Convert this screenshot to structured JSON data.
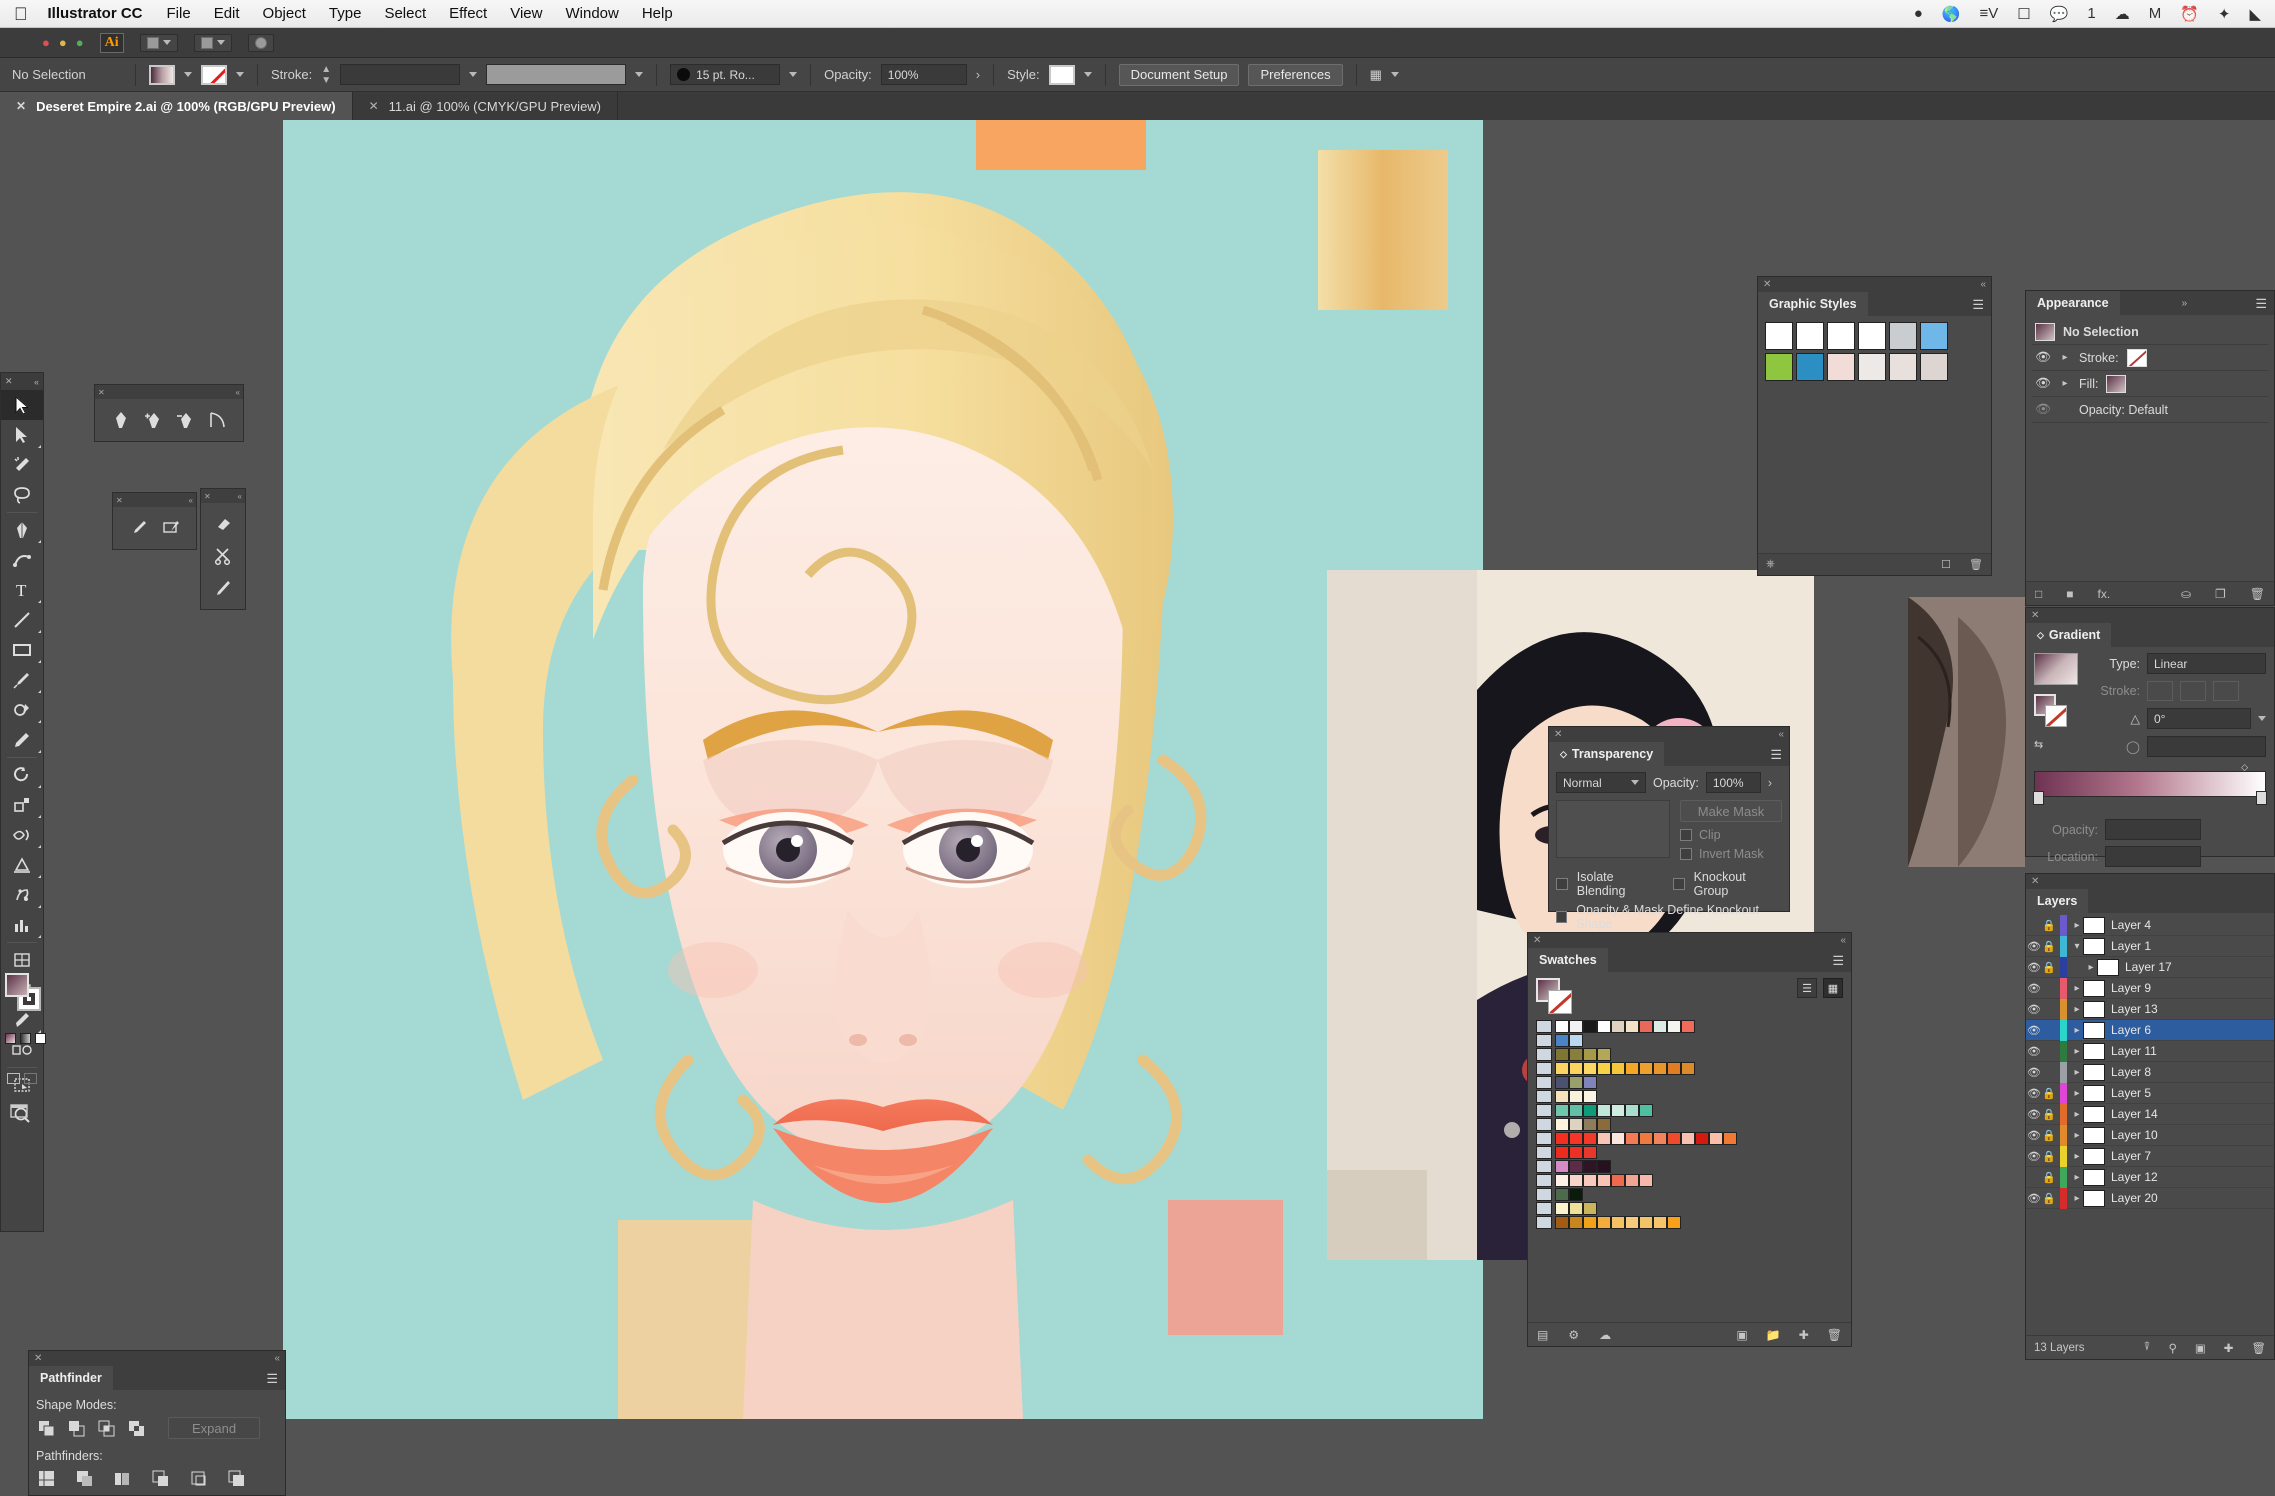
{
  "os_menu": {
    "apple_icon": "apple-icon",
    "app_name": "Illustrator CC",
    "items": [
      "File",
      "Edit",
      "Object",
      "Type",
      "Select",
      "Effect",
      "View",
      "Window",
      "Help"
    ],
    "status_icons": [
      "penguin-icon",
      "globe-icon",
      "input-method-icon",
      "screen-share-icon",
      "wechat-icon",
      "cloud-icon",
      "mail-icon",
      "time-machine-icon",
      "bluetooth-icon",
      "wifi-icon"
    ],
    "status_count": "1"
  },
  "appbar": {
    "logo_text": "Ai",
    "arrange_icon": "arrange-documents-icon",
    "workspace_icon": "workspace-switcher-icon"
  },
  "control_bar": {
    "selection_status": "No Selection",
    "fill_label": "fill-swatch",
    "stroke_label": "Stroke:",
    "stroke_weight": "",
    "brush_definition": "15 pt. Ro...",
    "opacity_label": "Opacity:",
    "opacity_value": "100%",
    "style_label": "Style:",
    "document_setup": "Document Setup",
    "preferences": "Preferences"
  },
  "document_tabs": [
    {
      "title": "Deseret Empire 2.ai @ 100% (RGB/GPU Preview)",
      "active": true
    },
    {
      "title": "11.ai @ 100% (CMYK/GPU Preview)",
      "active": false
    }
  ],
  "tools": [
    {
      "name": "selection-tool",
      "selected": true
    },
    {
      "name": "direct-selection-tool",
      "selected": false
    },
    {
      "name": "magic-wand-tool",
      "selected": false
    },
    {
      "name": "lasso-tool",
      "selected": false
    },
    {
      "name": "pen-tool",
      "selected": false
    },
    {
      "name": "curvature-tool",
      "selected": false
    },
    {
      "name": "type-tool",
      "selected": false
    },
    {
      "name": "line-segment-tool",
      "selected": false
    },
    {
      "name": "rectangle-tool",
      "selected": false
    },
    {
      "name": "paintbrush-tool",
      "selected": false
    },
    {
      "name": "shaper-tool",
      "selected": false
    },
    {
      "name": "pencil-tool",
      "selected": false
    },
    {
      "name": "rotate-tool",
      "selected": false
    },
    {
      "name": "free-transform-tool",
      "selected": false
    },
    {
      "name": "width-tool",
      "selected": false
    },
    {
      "name": "symbol-sprayer-tool",
      "selected": false
    },
    {
      "name": "column-graph-tool",
      "selected": false
    },
    {
      "name": "mesh-tool",
      "selected": false
    },
    {
      "name": "gradient-tool",
      "selected": false
    },
    {
      "name": "eyedropper-tool",
      "selected": false
    },
    {
      "name": "blend-tool",
      "selected": false
    },
    {
      "name": "artboard-tool",
      "selected": false
    },
    {
      "name": "zoom-tool",
      "selected": false
    }
  ],
  "flyouts": {
    "pen": [
      "pen-tool",
      "add-anchor-point-tool",
      "delete-anchor-point-tool",
      "anchor-point-tool"
    ],
    "brush": [
      "paintbrush-tool",
      "blob-brush-tool"
    ],
    "eraser": [
      "eraser-tool",
      "scissors-tool",
      "knife-tool"
    ]
  },
  "pathfinder": {
    "title": "Pathfinder",
    "shape_modes_label": "Shape Modes:",
    "expand_label": "Expand",
    "pathfinders_label": "Pathfinders:",
    "shape_modes": [
      "unite",
      "minus-front",
      "intersect",
      "exclude"
    ],
    "pathfinders": [
      "divide",
      "trim",
      "merge",
      "crop",
      "outline",
      "minus-back"
    ]
  },
  "graphic_styles": {
    "title": "Graphic Styles",
    "row1": [
      "#ffffff",
      "#ffffff",
      "#ffffff",
      "#ffffff",
      "#c9cdd0",
      "#6fb7e8"
    ],
    "row2": [
      "#8ec63f",
      "#2b8fc4",
      "#f2dcd8",
      "#ece9e6",
      "#e8e0dc",
      "#ddd5d1"
    ]
  },
  "appearance": {
    "title": "Appearance",
    "selection": "No Selection",
    "stroke_label": "Stroke:",
    "fill_label": "Fill:",
    "opacity_row": "Opacity: Default"
  },
  "gradient": {
    "title": "Gradient",
    "type_label": "Type:",
    "type_value": "Linear",
    "stroke_label": "Stroke:",
    "angle_value": "0°",
    "opacity_label": "Opacity:",
    "location_label": "Location:",
    "stop_colors": [
      "#6d3352",
      "#ffffff"
    ]
  },
  "transparency": {
    "title": "Transparency",
    "blend_mode": "Normal",
    "opacity_label": "Opacity:",
    "opacity_value": "100%",
    "make_mask": "Make Mask",
    "clip": "Clip",
    "invert_mask": "Invert Mask",
    "isolate_blending": "Isolate Blending",
    "knockout_group": "Knockout Group",
    "knockout_shape": "Opacity & Mask Define Knockout Shape"
  },
  "swatches": {
    "title": "Swatches",
    "view_list_icon": "list-view-icon",
    "view_grid_icon": "grid-view-icon",
    "rows": [
      [
        "#ffffff",
        "#f2f2f2",
        "#1a1a1a",
        "#ffffff",
        "#ded2c0",
        "#f0e3c6",
        "#e8695a",
        "#dcebe4",
        "#f5f5f0",
        "#f06a5c"
      ],
      [
        "#4a84c4",
        "#bcd8ee"
      ],
      [
        "#7d7733",
        "#8a7f3a",
        "#a79a47",
        "#b3a857"
      ],
      [
        "#fbd464",
        "#fbd45e",
        "#fbd863",
        "#f8d246",
        "#f5c53a",
        "#f5a623",
        "#eda12c",
        "#e8962a",
        "#e07c22",
        "#dd8a2b"
      ],
      [
        "#4d5170",
        "#9aa06d",
        "#8084b8"
      ],
      [
        "#f6e3bd",
        "#fbf0dc",
        "#fcf4e2"
      ],
      [
        "#6fc7ab",
        "#61c0a5",
        "#0e9b7a",
        "#bfe6d8",
        "#cfece0",
        "#a9ddcd",
        "#4fbfa1"
      ],
      [
        "#fdf4e0",
        "#ded3c0",
        "#8e7c5e",
        "#8a6b3e"
      ],
      [
        "#f42f1f",
        "#f43527",
        "#f23a28",
        "#f9c6b6",
        "#fbe6dd",
        "#f47a55",
        "#f0793f",
        "#f3835a",
        "#ef4a2c",
        "#f8c0b0",
        "#d21a10",
        "#f9bdaa",
        "#f07a33"
      ],
      [
        "#ed2a1d",
        "#ec3025",
        "#e8382c"
      ],
      [
        "#d58cc6",
        "#5e2a4a",
        "#2f1428",
        "#27101f"
      ],
      [
        "#fdf1e8",
        "#f7d5c9",
        "#f6c9bc",
        "#f7c3b4",
        "#ef6a4a",
        "#f2a492",
        "#f5b8ab"
      ],
      [
        "#4d6b4c",
        "#0c1a0b"
      ],
      [
        "#fcf3cf",
        "#efe09a",
        "#c9b55c"
      ],
      [
        "#a35c14",
        "#c9861c",
        "#f0a218",
        "#f2ad3c",
        "#f5c263",
        "#f6cb7b",
        "#f3c269",
        "#f6c46a",
        "#f9a01b"
      ]
    ]
  },
  "layers": {
    "title": "Layers",
    "footer_count": "13 Layers",
    "items": [
      {
        "name": "Layer 4",
        "visible": false,
        "locked": true,
        "color": "#6a5acd",
        "indent": 0,
        "expanded": false,
        "selected": false
      },
      {
        "name": "Layer 1",
        "visible": true,
        "locked": true,
        "color": "#3fb6d3",
        "indent": 0,
        "expanded": true,
        "selected": false
      },
      {
        "name": "Layer 17",
        "visible": true,
        "locked": true,
        "color": "#2b3fa0",
        "indent": 1,
        "expanded": false,
        "selected": false
      },
      {
        "name": "Layer 9",
        "visible": true,
        "locked": false,
        "color": "#e8596b",
        "indent": 0,
        "expanded": false,
        "selected": false
      },
      {
        "name": "Layer 13",
        "visible": true,
        "locked": false,
        "color": "#d9902f",
        "indent": 0,
        "expanded": false,
        "selected": false
      },
      {
        "name": "Layer 6",
        "visible": true,
        "locked": false,
        "color": "#2ad6c9",
        "indent": 0,
        "expanded": false,
        "selected": true
      },
      {
        "name": "Layer 11",
        "visible": true,
        "locked": false,
        "color": "#2f7a3e",
        "indent": 0,
        "expanded": false,
        "selected": false
      },
      {
        "name": "Layer 8",
        "visible": true,
        "locked": false,
        "color": "#9aa0a6",
        "indent": 0,
        "expanded": false,
        "selected": false
      },
      {
        "name": "Layer 5",
        "visible": true,
        "locked": true,
        "color": "#e046d6",
        "indent": 0,
        "expanded": false,
        "selected": false
      },
      {
        "name": "Layer 14",
        "visible": true,
        "locked": true,
        "color": "#e06b2b",
        "indent": 0,
        "expanded": false,
        "selected": false
      },
      {
        "name": "Layer 10",
        "visible": true,
        "locked": true,
        "color": "#e08a2b",
        "indent": 0,
        "expanded": false,
        "selected": false
      },
      {
        "name": "Layer 7",
        "visible": true,
        "locked": true,
        "color": "#e8d22b",
        "indent": 0,
        "expanded": false,
        "selected": false
      },
      {
        "name": "Layer 12",
        "visible": false,
        "locked": true,
        "color": "#3fa85a",
        "indent": 0,
        "expanded": false,
        "selected": false
      },
      {
        "name": "Layer 20",
        "visible": true,
        "locked": true,
        "color": "#d62b2b",
        "indent": 0,
        "expanded": false,
        "selected": false
      }
    ],
    "footer_icons": [
      "collect-in-new-layer-icon",
      "locate-object-icon",
      "make-sublayer-icon",
      "new-layer-icon",
      "delete-layer-icon"
    ]
  },
  "artwork": {
    "background_color": "#a5d9d3",
    "hair_color": "#f7e2a8",
    "hair_shadow": "#e6c97f",
    "skin_color": "#fbe4dc",
    "lips_color": "#f4775a",
    "eye_iris": "#8e8296",
    "blush_color": "#f79a7c",
    "rect_orange": "#f9a562",
    "rect_gold": "#eabe69",
    "rect_pink": "#f79a8a"
  }
}
